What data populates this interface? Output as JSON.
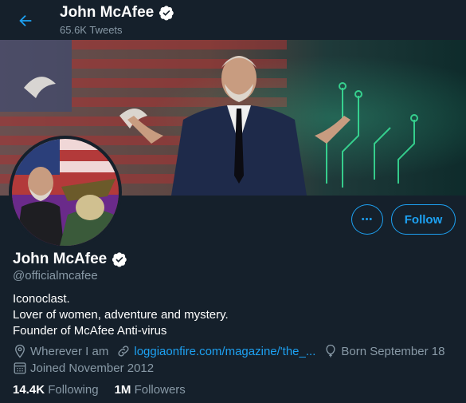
{
  "header": {
    "name": "John McAfee",
    "tweet_count": "65.6K Tweets"
  },
  "profile": {
    "name": "John McAfee",
    "handle": "@officialmcafee",
    "bio": [
      "Iconoclast.",
      "Lover of women, adventure and mystery.",
      "Founder of McAfee Anti-virus"
    ],
    "location": "Wherever I am",
    "website": "loggiaonfire.com/magazine/'the_...",
    "birthday": "Born September 18",
    "joined": "Joined November 2012",
    "following_count": "14.4K",
    "following_label": "Following",
    "followers_count": "1M",
    "followers_label": "Followers"
  },
  "buttons": {
    "more": "•••",
    "follow": "Follow"
  },
  "icons": {
    "back": "arrow-left-icon",
    "verified": "verified-badge-icon",
    "location": "location-pin-icon",
    "link": "link-icon",
    "birthday": "balloon-icon",
    "calendar": "calendar-icon"
  },
  "colors": {
    "background": "#15202b",
    "accent": "#1da1f2",
    "secondary_text": "#8899a6"
  }
}
